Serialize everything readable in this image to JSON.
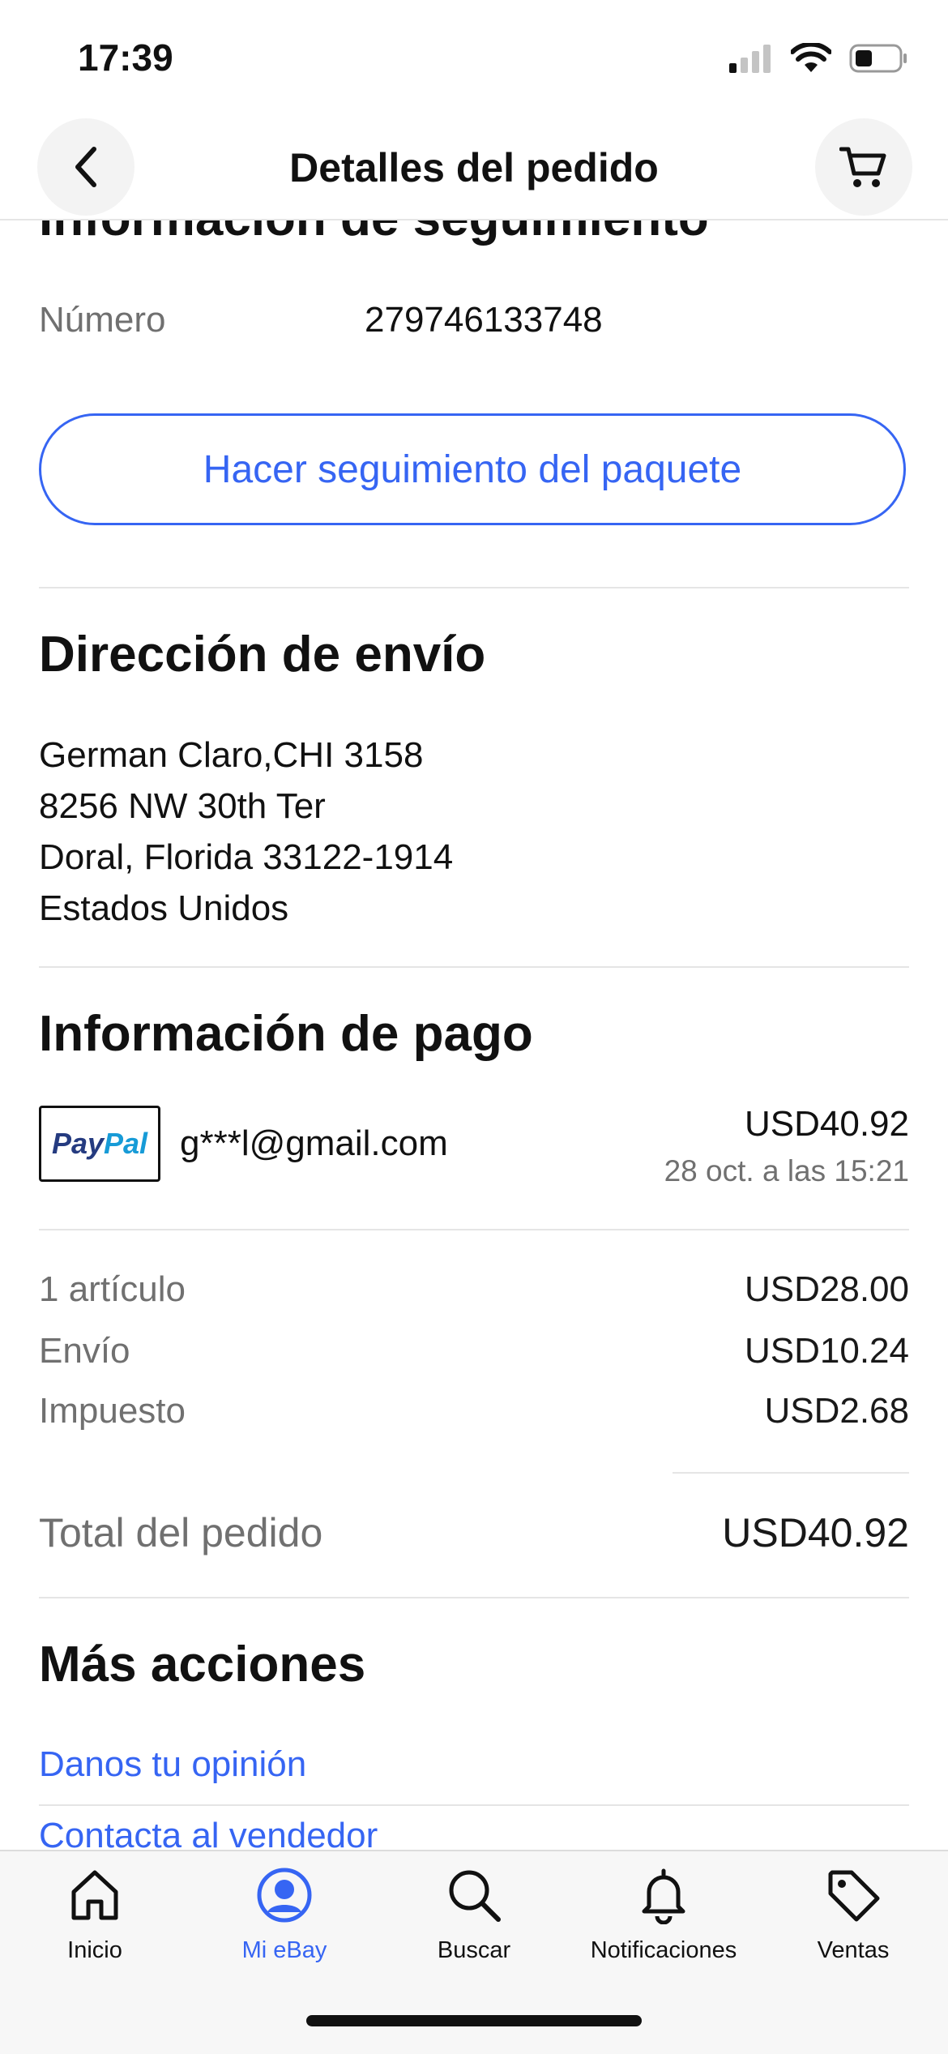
{
  "status_bar": {
    "time": "17:39"
  },
  "header": {
    "title": "Detalles del pedido"
  },
  "tracking": {
    "title": "Información de seguimiento",
    "number_label": "Número",
    "number_value": "279746133748",
    "track_button": "Hacer seguimiento del paquete"
  },
  "shipping": {
    "title": "Dirección de envío",
    "lines": [
      "German Claro,CHI 3158",
      "8256 NW 30th Ter",
      "Doral, Florida 33122-1914",
      "Estados Unidos"
    ]
  },
  "payment": {
    "title": "Información de pago",
    "method_logo": "PayPal",
    "account": "g***l@gmail.com",
    "amount": "USD40.92",
    "date": "28 oct. a las 15:21"
  },
  "summary": {
    "rows": [
      {
        "label": "1 artículo",
        "value": "USD28.00"
      },
      {
        "label": "Envío",
        "value": "USD10.24"
      },
      {
        "label": "Impuesto",
        "value": "USD2.68"
      }
    ],
    "total_label": "Total del pedido",
    "total_value": "USD40.92"
  },
  "actions": {
    "title": "Más acciones",
    "links": [
      "Danos tu opinión",
      "Contacta al vendedor"
    ]
  },
  "bottom_nav": {
    "items": [
      {
        "label": "Inicio",
        "icon": "home-icon",
        "active": false
      },
      {
        "label": "Mi eBay",
        "icon": "profile-icon",
        "active": true
      },
      {
        "label": "Buscar",
        "icon": "search-icon",
        "active": false
      },
      {
        "label": "Notificaciones",
        "icon": "bell-icon",
        "active": false
      },
      {
        "label": "Ventas",
        "icon": "tag-icon",
        "active": false
      }
    ]
  },
  "colors": {
    "accent": "#3665f3",
    "text": "#191919",
    "muted": "#707070",
    "paypal_dark": "#253b80",
    "paypal_light": "#179bd7"
  }
}
